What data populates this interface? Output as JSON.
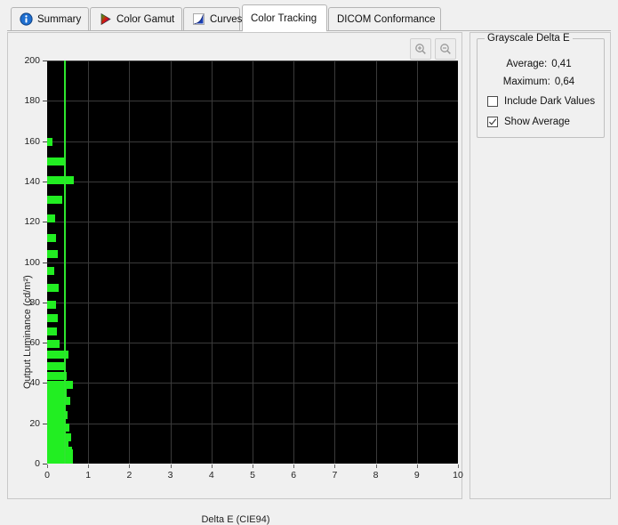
{
  "tabs": [
    {
      "label": "Summary",
      "icon": "info-icon",
      "active": false
    },
    {
      "label": "Color Gamut",
      "icon": "gamut-triangle-icon",
      "active": false
    },
    {
      "label": "Curves",
      "icon": "curve-graph-icon",
      "active": false
    },
    {
      "label": "Color Tracking",
      "icon": "none",
      "active": true
    },
    {
      "label": "DICOM Conformance",
      "icon": "none",
      "active": false
    }
  ],
  "chart_toolbar": {
    "zoom_in_label": "zoom-in",
    "zoom_out_label": "zoom-out"
  },
  "sidepanel": {
    "group_title": "Grayscale Delta E",
    "average_label": "Average:",
    "average_value": "0,41",
    "maximum_label": "Maximum:",
    "maximum_value": "0,64",
    "include_dark_label": "Include Dark Values",
    "include_dark_checked": false,
    "show_average_label": "Show Average",
    "show_average_checked": true
  },
  "colors": {
    "bar": "#22ee22",
    "average_line": "#2ee62e",
    "plot_background": "#000000",
    "gridline": "#3a3a3a",
    "panel_background": "#f0f0f0"
  },
  "chart_data": {
    "type": "bar",
    "orientation": "horizontal",
    "title": "",
    "xlabel": "Delta E (CIE94)",
    "ylabel": "Output Luminance (cd/m²)",
    "xlim": [
      0,
      10
    ],
    "ylim": [
      0,
      200
    ],
    "xticks": [
      0,
      1,
      2,
      3,
      4,
      5,
      6,
      7,
      8,
      9,
      10
    ],
    "yticks": [
      0,
      20,
      40,
      60,
      80,
      100,
      120,
      140,
      160,
      180,
      200
    ],
    "grid": true,
    "legend": null,
    "average_line_value": 0.41,
    "maximum_value": 0.64,
    "categories": [
      159.5,
      150.0,
      140.5,
      131.0,
      121.5,
      112.0,
      104.0,
      95.5,
      87.0,
      79.0,
      72.0,
      65.5,
      59.5,
      54.0,
      48.5,
      43.5,
      39.0,
      35.0,
      31.0,
      27.5,
      24.0,
      21.0,
      18.0,
      15.5,
      13.0,
      11.0,
      9.2,
      7.6,
      6.2,
      5.0,
      3.8,
      2.6
    ],
    "values": [
      0.13,
      0.43,
      0.64,
      0.36,
      0.2,
      0.22,
      0.25,
      0.17,
      0.28,
      0.21,
      0.26,
      0.24,
      0.3,
      0.52,
      0.44,
      0.48,
      0.62,
      0.47,
      0.56,
      0.42,
      0.5,
      0.46,
      0.54,
      0.41,
      0.58,
      0.49,
      0.53,
      0.45,
      0.6,
      0.63,
      0.57,
      0.51
    ]
  }
}
